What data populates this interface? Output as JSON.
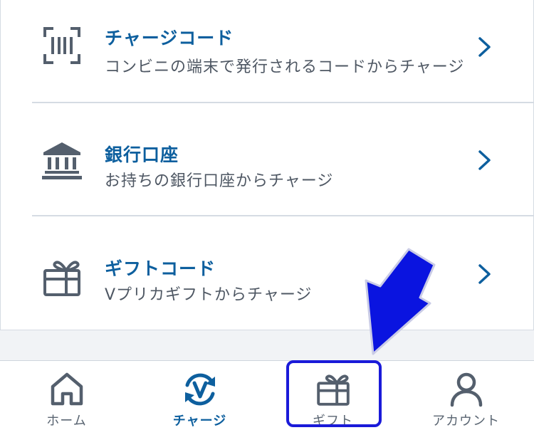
{
  "charge_methods": [
    {
      "icon": "barcode-scan-icon",
      "title": "チャージコード",
      "subtitle": "コンビニの端末で発行されるコードからチャージ"
    },
    {
      "icon": "bank-icon",
      "title": "銀行口座",
      "subtitle": "お持ちの銀行口座からチャージ"
    },
    {
      "icon": "gift-icon",
      "title": "ギフトコード",
      "subtitle": "Vプリカギフトからチャージ"
    }
  ],
  "tabbar": {
    "items": [
      {
        "label": "ホーム",
        "icon": "home-icon"
      },
      {
        "label": "チャージ",
        "icon": "charge-icon",
        "active": true
      },
      {
        "label": "ギフト",
        "icon": "gift-icon"
      },
      {
        "label": "アカウント",
        "icon": "account-icon"
      }
    ]
  },
  "colors": {
    "accent": "#0d5f9e",
    "icon": "#545f6d",
    "highlight": "#1a1ad9",
    "arrow_fill": "#0a14e0",
    "background": "#f1f3f6"
  }
}
